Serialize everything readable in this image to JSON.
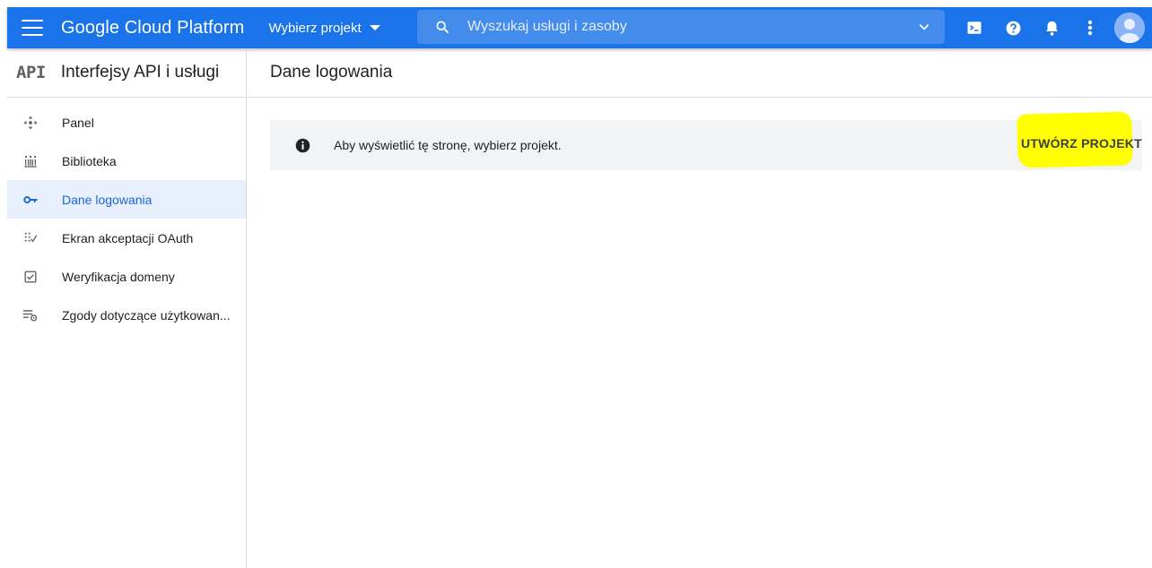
{
  "topbar": {
    "brand": "Google Cloud Platform",
    "project_picker": "Wybierz projekt",
    "search": {
      "placeholder": "Wyszukaj usługi i zasoby"
    },
    "colors": {
      "bar": "#1a73e8"
    },
    "icons": [
      "menu-icon",
      "terminal-icon",
      "help-icon",
      "bell-icon",
      "more-vert-icon",
      "account-avatar"
    ]
  },
  "sidebar": {
    "logo": "API",
    "title": "Interfejsy API i usługi",
    "items": [
      {
        "label": "Panel",
        "icon": "dashboard-icon",
        "active": false
      },
      {
        "label": "Biblioteka",
        "icon": "library-icon",
        "active": false
      },
      {
        "label": "Dane logowania",
        "icon": "key-icon",
        "active": true
      },
      {
        "label": "Ekran akceptacji OAuth",
        "icon": "oauth-icon",
        "active": false
      },
      {
        "label": "Weryfikacja domeny",
        "icon": "checkbox-icon",
        "active": false
      },
      {
        "label": "Zgody dotyczące użytkowan...",
        "icon": "settings-list-icon",
        "active": false
      }
    ]
  },
  "main": {
    "title": "Dane logowania",
    "banner": {
      "text": "Aby wyświetlić tę stronę, wybierz projekt.",
      "button": "UTWÓRZ PROJEKT",
      "highlight_color": "#ffff00"
    }
  }
}
